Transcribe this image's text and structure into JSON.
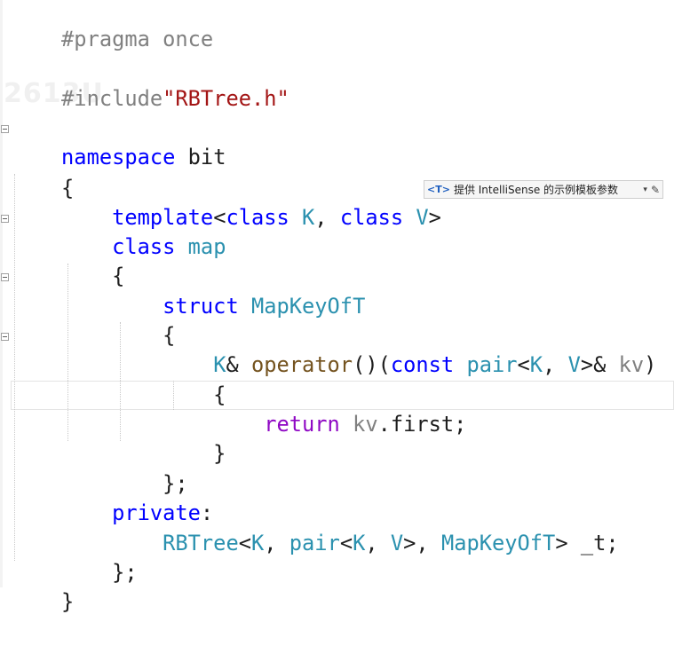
{
  "watermark": "2613U",
  "tooltip": {
    "icon": "<T>",
    "text": "提供 IntelliSense 的示例模板参数",
    "dropdown_glyph": "▾",
    "edit_glyph": "✎"
  },
  "code": {
    "l1": {
      "a": "#pragma once"
    },
    "l2": {
      "a": "#include",
      "b": "\"RBTree.h\""
    },
    "l3": {
      "a": "namespace",
      "b": " bit"
    },
    "l4": {
      "a": "{"
    },
    "l5": {
      "a": "    ",
      "b": "template",
      "c": "<",
      "d": "class",
      "e": " ",
      "f": "K",
      "g": ", ",
      "h": "class",
      "i": " ",
      "j": "V",
      "k": ">"
    },
    "l6": {
      "a": "    ",
      "b": "class",
      "c": " ",
      "d": "map"
    },
    "l7": {
      "a": "    {"
    },
    "l8": {
      "a": "        ",
      "b": "struct",
      "c": " ",
      "d": "MapKeyOfT"
    },
    "l9": {
      "a": "        {"
    },
    "l10": {
      "a": "            ",
      "b": "K",
      "c": "& ",
      "d": "operator",
      "e": "()(",
      "f": "const",
      "g": " ",
      "h": "pair",
      "i": "<",
      "j": "K",
      "k": ", ",
      "l": "V",
      "m": ">& ",
      "n": "kv",
      "o": ")"
    },
    "l11": {
      "a": "            {"
    },
    "l12": {
      "a": "                ",
      "b": "return",
      "c": " ",
      "d": "kv",
      "e": ".first;"
    },
    "l13": {
      "a": "            }"
    },
    "l14": {
      "a": "        };"
    },
    "l15": {
      "a": "    ",
      "b": "private",
      "c": ":"
    },
    "l16": {
      "a": "        ",
      "b": "RBTree",
      "c": "<",
      "d": "K",
      "e": ", ",
      "f": "pair",
      "g": "<",
      "h": "K",
      "i": ", ",
      "j": "V",
      "k": ">, ",
      "l": "MapKeyOfT",
      "m": "> _t;"
    },
    "l17": {
      "a": "    };"
    },
    "l18": {
      "a": "}"
    }
  }
}
